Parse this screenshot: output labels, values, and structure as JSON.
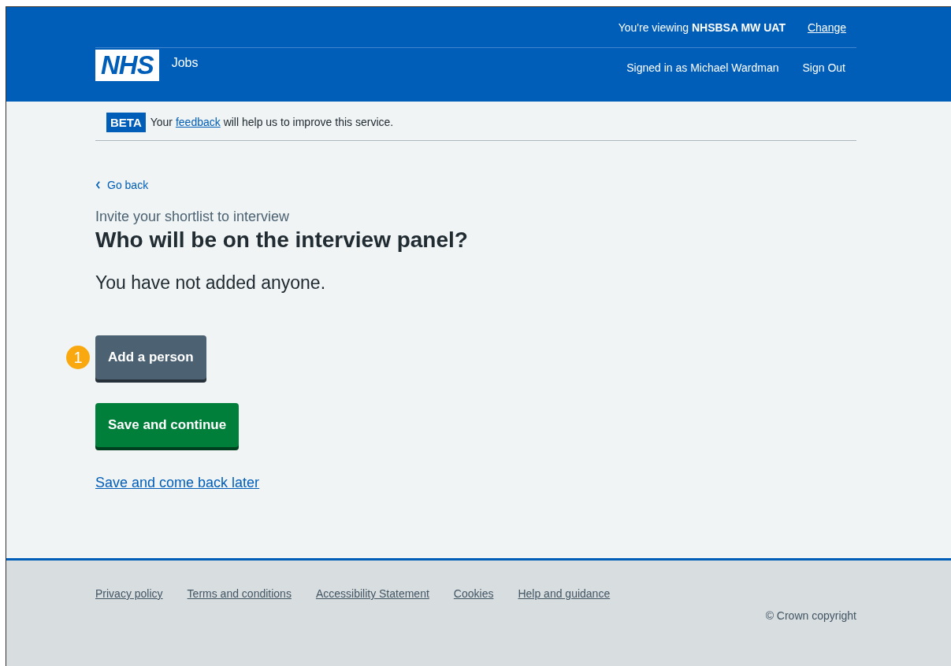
{
  "header": {
    "logo": "NHS",
    "service": "Jobs",
    "viewing": "You're viewing **NHSBSA MW UAT**",
    "change_link": "Change",
    "signed_in": "Signed in as Michael Wardman",
    "sign_out": "Sign Out"
  },
  "beta_banner": {
    "tag": "BETA",
    "before": "Your",
    "link": "feedback",
    "after": "will help us to improve this service."
  },
  "back_link": "Go back",
  "caption": "Invite your shortlist to interview",
  "heading": "Who will be on the interview panel?",
  "body": "You have not added anyone.",
  "annotation_marker": "1",
  "buttons": [
    {
      "label": "Add a person",
      "kind": "secondary"
    },
    {
      "label": "Save and continue",
      "kind": "primary"
    }
  ],
  "later_link": "Save and come back later",
  "footer": {
    "links": [
      "Privacy policy",
      "Terms and conditions",
      "Accessibility Statement",
      "Cookies",
      "Help and guidance"
    ],
    "copyright": "© Crown copyright"
  }
}
